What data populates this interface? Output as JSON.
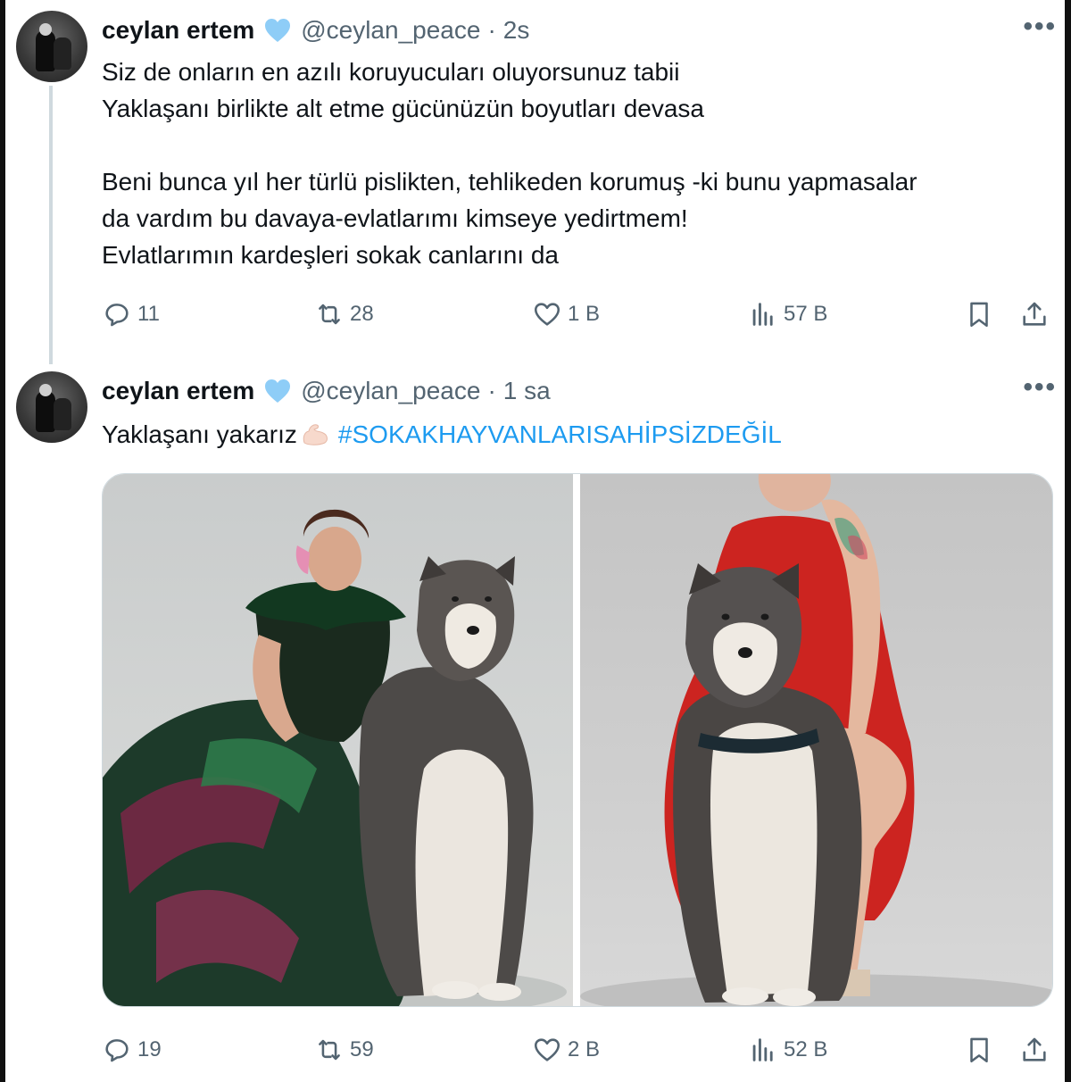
{
  "tweets": [
    {
      "author_name": "ceylan ertem",
      "handle": "@ceylan_peace",
      "separator": "·",
      "time": "2s",
      "lines": [
        "Siz de onların en azılı koruyucuları oluyorsunuz tabii",
        "Yaklaşanı birlikte alt etme gücünüzün boyutları devasa",
        "",
        "Beni bunca yıl her türlü pislikten, tehlikeden korumuş -ki bunu yapmasalar",
        "da vardım bu davaya-evlatlarımı kimseye yedirtmem!",
        "Evlatlarımın kardeşleri sokak canlarını da"
      ],
      "replies": "11",
      "reposts": "28",
      "likes": "1 B",
      "views": "57 B"
    },
    {
      "author_name": "ceylan ertem",
      "handle": "@ceylan_peace",
      "separator": "·",
      "time": "1 sa",
      "text": "Yaklaşanı yakarız",
      "emoji": "flexed-biceps-emoji",
      "hashtag": "#SOKAKHAYVANLARISAHİPSİZDEĞİL",
      "media": [
        {
          "alt": "woman in green patterned dress sitting with husky dog"
        },
        {
          "alt": "woman in red dress sitting behind husky dog"
        }
      ],
      "replies": "19",
      "reposts": "59",
      "likes": "2 B",
      "views": "52 B"
    }
  ],
  "icons": {
    "verified": "verified-heart-badge-icon",
    "more": "more-horizontal-icon",
    "reply": "reply-icon",
    "repost": "repost-icon",
    "like": "heart-icon",
    "views": "views-chart-icon",
    "bookmark": "bookmark-icon",
    "share": "share-icon"
  },
  "colors": {
    "link": "#1d9bf0",
    "secondary_text": "#536471",
    "badge": "#8ecdf7"
  }
}
